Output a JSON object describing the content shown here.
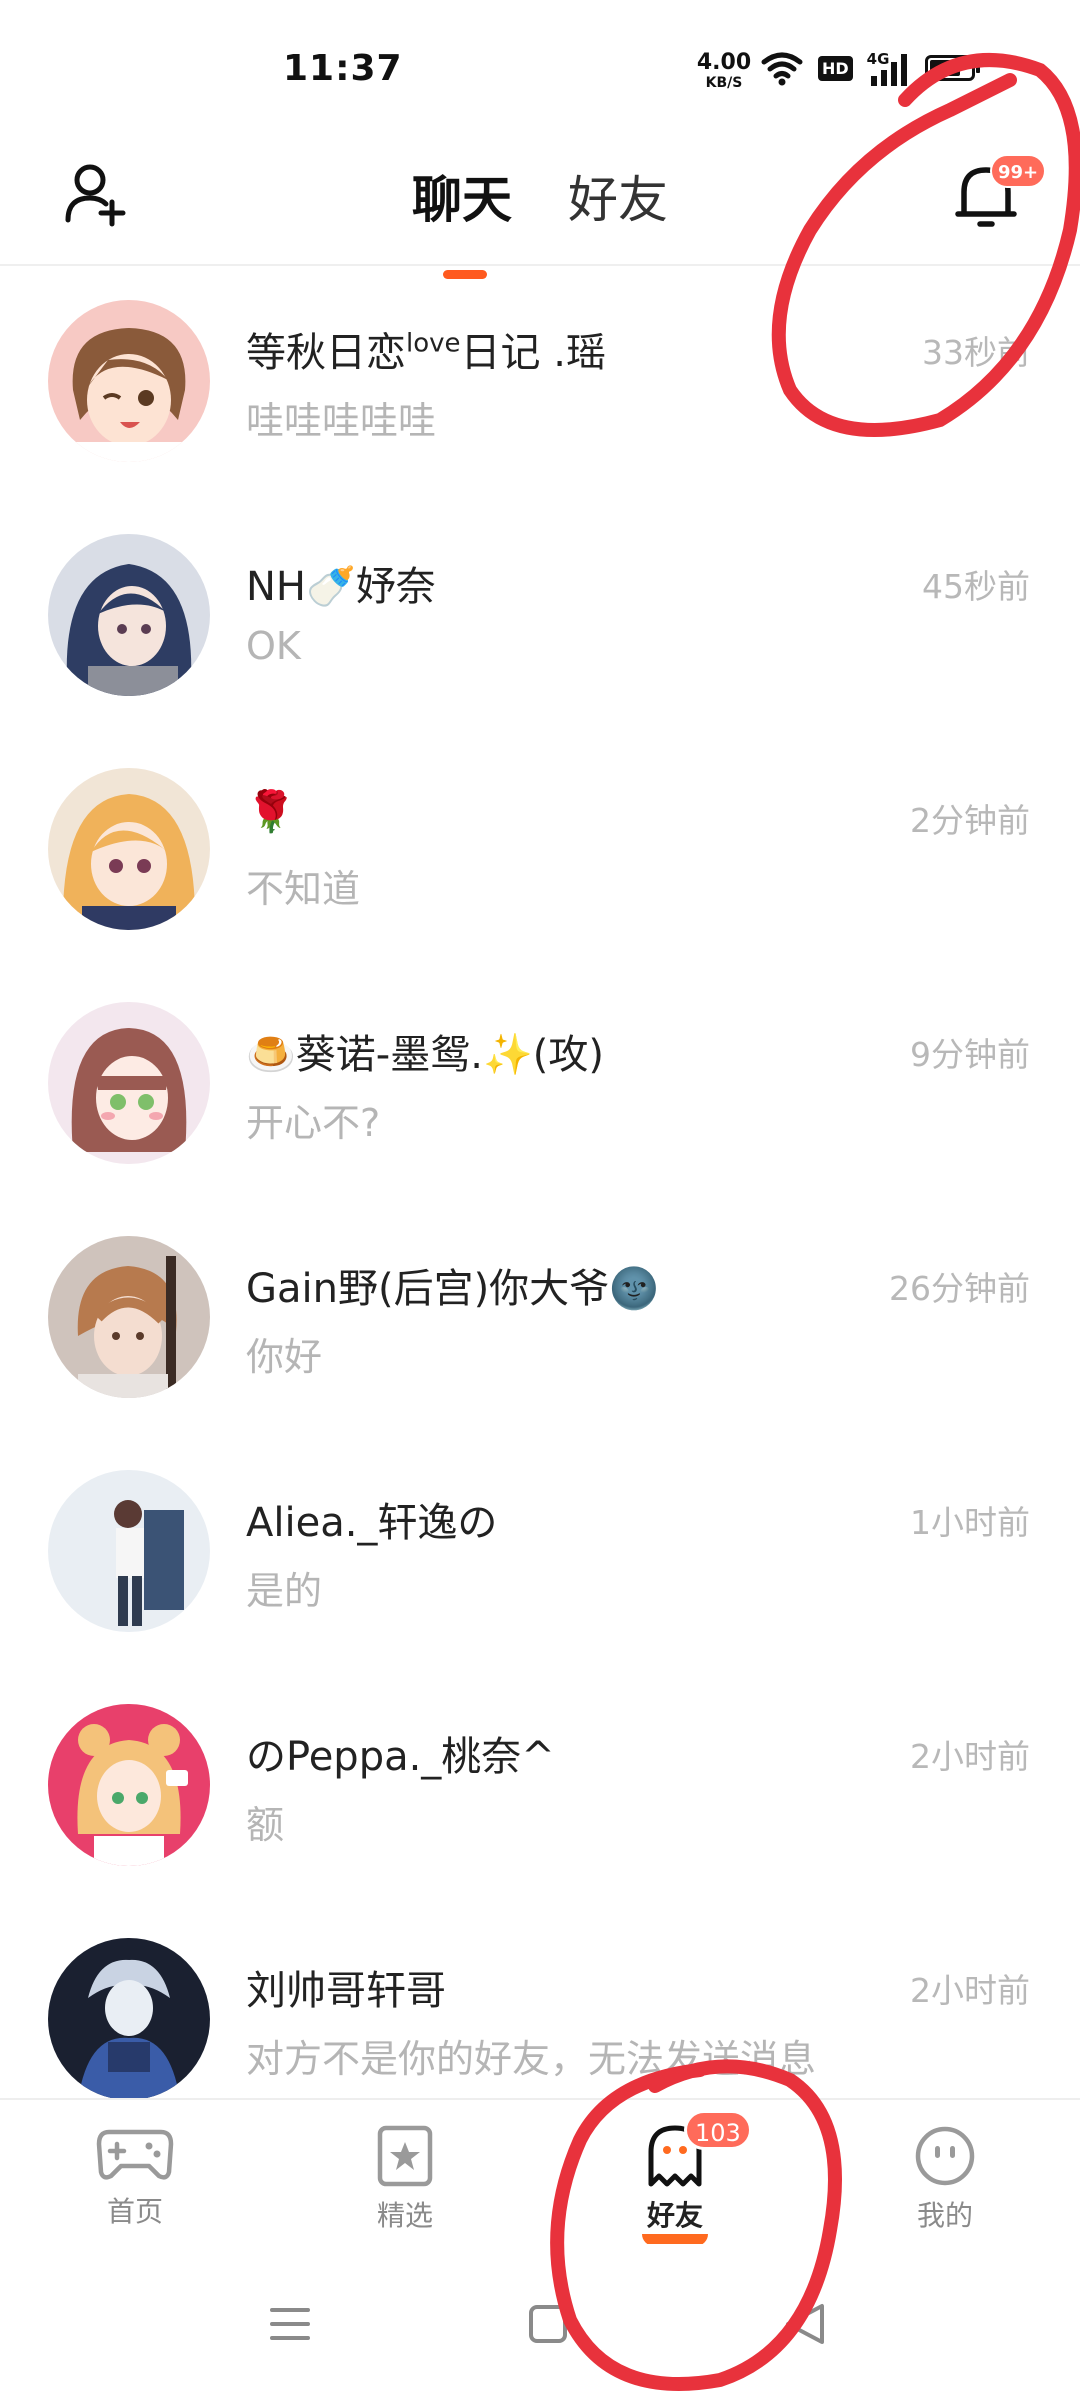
{
  "status_bar": {
    "time": "11:37",
    "net_speed_value": "4.00",
    "net_speed_unit": "KB/S",
    "hd_label": "HD",
    "network_label": "4G",
    "icons": [
      "wifi-icon",
      "hd-icon",
      "signal-4g-icon",
      "battery-icon"
    ]
  },
  "header": {
    "tabs": [
      {
        "label": "聊天",
        "active": true
      },
      {
        "label": "好友",
        "active": false
      }
    ],
    "notification_badge": "99+",
    "accent_color": "#ff5a1f"
  },
  "chats": [
    {
      "name": "等秋日恋",
      "name_sup": "love",
      "name_tail": "日记 .瑶",
      "preview": "哇哇哇哇哇",
      "time": "33秒前"
    },
    {
      "name": "NH🍼妤奈",
      "name_sup": "",
      "name_tail": "",
      "preview": "OK",
      "time": "45秒前"
    },
    {
      "name": "🌹",
      "name_sup": "",
      "name_tail": "",
      "preview": "不知道",
      "time": "2分钟前"
    },
    {
      "name": "🍮葵诺-墨鸳.✨(攻)",
      "name_sup": "",
      "name_tail": "",
      "preview": "开心不?",
      "time": "9分钟前"
    },
    {
      "name": "Gain野(后宫)你大爷🌚",
      "name_sup": "",
      "name_tail": "",
      "preview": "你好",
      "time": "26分钟前"
    },
    {
      "name": "Aliea._轩逸の",
      "name_sup": "",
      "name_tail": "",
      "preview": "是的",
      "time": "1小时前"
    },
    {
      "name": "のPeppa._桃奈^",
      "name_sup": "",
      "name_tail": "",
      "preview": "额",
      "time": "2小时前"
    },
    {
      "name": "刘帅哥轩哥",
      "name_sup": "",
      "name_tail": "",
      "preview": "对方不是你的好友，无法发送消息",
      "time": "2小时前"
    }
  ],
  "bottom_nav": {
    "items": [
      {
        "label": "首页",
        "icon": "gamepad-icon",
        "active": false
      },
      {
        "label": "精选",
        "icon": "star-card-icon",
        "active": false
      },
      {
        "label": "好友",
        "icon": "ghost-icon",
        "active": true,
        "badge": "103"
      },
      {
        "label": "我的",
        "icon": "smiley-icon",
        "active": false
      }
    ]
  },
  "system_nav": {
    "buttons": [
      "menu-icon",
      "home-square-icon",
      "back-triangle-icon"
    ]
  },
  "colors": {
    "badge": "#ff6b5a",
    "annotation": "#e8323c",
    "muted_text": "#b5b5b5"
  }
}
